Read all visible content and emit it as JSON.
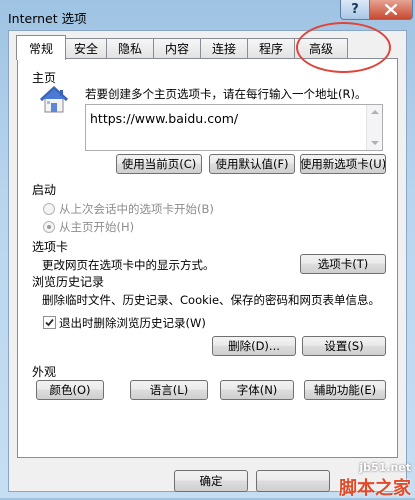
{
  "window": {
    "title": "Internet 选项",
    "help_label": "?",
    "close_label": "x"
  },
  "tabs": [
    {
      "label": "常规",
      "active": true
    },
    {
      "label": "安全"
    },
    {
      "label": "隐私"
    },
    {
      "label": "内容"
    },
    {
      "label": "连接"
    },
    {
      "label": "程序"
    },
    {
      "label": "高级"
    }
  ],
  "homepage": {
    "header": "主页",
    "instruction": "若要创建多个主页选项卡，请在每行输入一个地址(R)。",
    "url": "https://www.baidu.com/",
    "icon": "house-icon",
    "buttons": {
      "use_current": "使用当前页(C)",
      "use_default": "使用默认值(F)",
      "use_new_tab": "使用新选项卡(U)"
    }
  },
  "startup": {
    "header": "启动",
    "option_last_session": "从上次会话中的选项卡开始(B)",
    "option_homepage": "从主页开始(H)"
  },
  "tabs_section": {
    "header": "选项卡",
    "description": "更改网页在选项卡中的显示方式。",
    "button": "选项卡(T)"
  },
  "history": {
    "header": "浏览历史记录",
    "description": "删除临时文件、历史记录、Cookie、保存的密码和网页表单信息。",
    "checkbox_label": "退出时删除浏览历史记录(W)",
    "checked": true,
    "delete_button": "删除(D)...",
    "settings_button": "设置(S)"
  },
  "appearance": {
    "header": "外观",
    "colors_button": "颜色(O)",
    "languages_button": "语言(L)",
    "fonts_button": "字体(N)",
    "accessibility_button": "辅助功能(E)"
  },
  "footer": {
    "ok_button": "确定"
  },
  "watermark": {
    "line1": "jb51.net",
    "line2": "脚本之家"
  },
  "colors": {
    "annotation": "#e0443a",
    "close_button": "#c84a31",
    "titlebar": "#b9d5ee"
  }
}
